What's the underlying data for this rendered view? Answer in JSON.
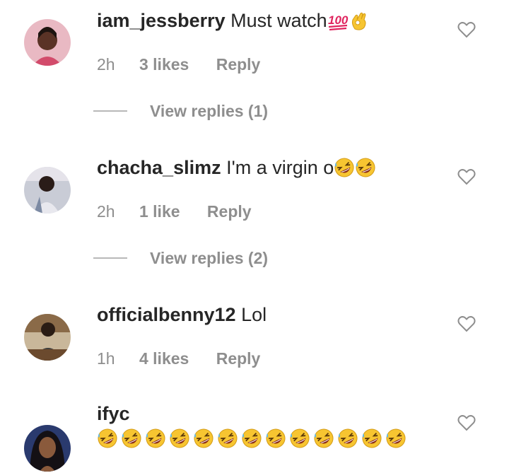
{
  "comments": [
    {
      "username": "iam_jessberry",
      "text": "Must watch",
      "emojis": [
        "hundred-points-emoji",
        "ok-hand-emoji"
      ],
      "time": "2h",
      "likes": "3 likes",
      "reply": "Reply",
      "view_replies": "View replies (1)"
    },
    {
      "username": "chacha_slimz",
      "text": "I'm a virgin o",
      "emojis": [
        "rofl-emoji",
        "rofl-emoji"
      ],
      "time": "2h",
      "likes": "1 like",
      "reply": "Reply",
      "view_replies": "View replies (2)"
    },
    {
      "username": "officialbenny12",
      "text": "Lol",
      "time": "1h",
      "likes": "4 likes",
      "reply": "Reply"
    },
    {
      "username": "ifyc",
      "emoji_count": 13,
      "emoji": "rofl-emoji"
    }
  ],
  "colors": {
    "text": "#262626",
    "meta": "#8e8e8e",
    "heart_outline": "#8e8e8e",
    "emoji_yellow": "#f7c531"
  },
  "icons": {
    "like": "heart-outline-icon"
  }
}
